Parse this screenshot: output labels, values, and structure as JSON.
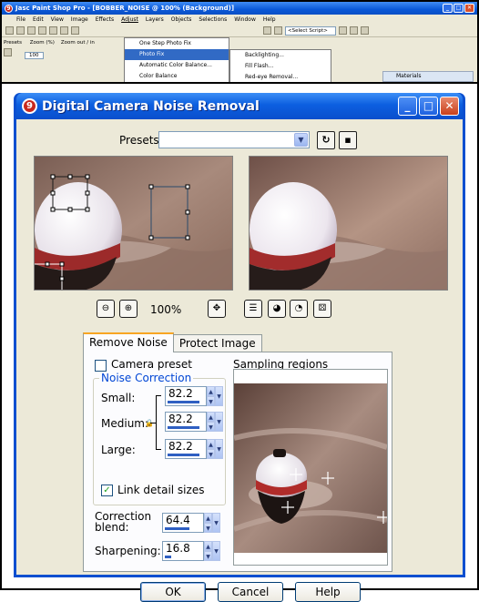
{
  "app": {
    "title": "Jasc Paint Shop Pro - [BOBBER_NOISE @ 100% (Background)]",
    "logo": "9",
    "title_buttons": [
      "_",
      "□",
      "✕"
    ],
    "menu": [
      "File",
      "Edit",
      "View",
      "Image",
      "Effects",
      "Adjust",
      "Layers",
      "Objects",
      "Selections",
      "Window",
      "Help"
    ],
    "script_placeholder": "<Select Script>",
    "props": {
      "presets": "Presets",
      "zoom": "Zoom (%)",
      "zoom_out_in": "Zoom out / in",
      "zoom_value": "100"
    },
    "adjust_menu": [
      "One Step Photo Fix",
      "Photo Fix",
      "Automatic Color Balance...",
      "Color Balance"
    ],
    "photo_fix_submenu": [
      "Backlighting...",
      "Fill Flash...",
      "Red-eye Removal..."
    ],
    "materials_label": "Materials"
  },
  "dialog": {
    "logo": "9",
    "title": "Digital Camera Noise Removal",
    "title_buttons": {
      "minimize": "_",
      "maximize": "□",
      "close": "✕"
    },
    "presets_label": "Presets:",
    "presets_value": "",
    "zoom_label": "100%",
    "tabs": [
      {
        "label": "Remove Noise",
        "active": true
      },
      {
        "label": "Protect Image",
        "active": false
      }
    ],
    "camera_preset": {
      "label": "Camera preset",
      "checked": false
    },
    "noise_correction": {
      "title": "Noise Correction",
      "small": {
        "label": "Small:",
        "value": "82.2",
        "fill": 0.822
      },
      "medium": {
        "label": "Medium:",
        "value": "82.2",
        "fill": 0.822
      },
      "large": {
        "label": "Large:",
        "value": "82.2",
        "fill": 0.822
      }
    },
    "link_detail": {
      "label": "Link detail sizes",
      "checked": true,
      "mark": "✓"
    },
    "correction_blend": {
      "label": "Correction blend:",
      "value": "64.4",
      "fill": 0.644
    },
    "sharpening": {
      "label": "Sharpening:",
      "value": "16.8",
      "fill": 0.168
    },
    "sampling_label": "Sampling regions",
    "buttons": {
      "ok": "OK",
      "cancel": "Cancel",
      "help": "Help"
    }
  },
  "colors": {
    "title_blue": "#0a4fd0",
    "face": "#ece9d8",
    "group_blue": "#0046d5",
    "accent_orange": "#f8a623"
  }
}
